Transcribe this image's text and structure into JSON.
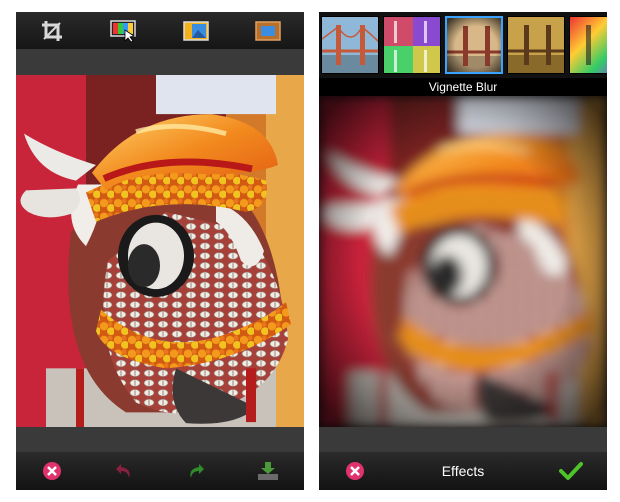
{
  "right": {
    "effect_name": "Vignette Blur",
    "bottom_title": "Effects"
  },
  "colors": {
    "accent": "#3aa3ff",
    "cancel": "#e0336e",
    "confirm": "#4fc32a",
    "toolbar_bg": "#161616"
  },
  "icons": {
    "left_toolbar": [
      "crop-icon",
      "color-palette-icon",
      "image-adjust-icon",
      "frame-icon"
    ],
    "left_bottom": [
      "cancel-icon",
      "undo-icon",
      "redo-icon",
      "save-icon"
    ],
    "right_bottom": [
      "cancel-icon",
      "checkmark-icon"
    ]
  },
  "effects": {
    "thumbnails": [
      "thumb-effect-1",
      "thumb-effect-2",
      "thumb-vignette-blur",
      "thumb-effect-4",
      "thumb-effect-5"
    ],
    "selected_index": 2
  }
}
